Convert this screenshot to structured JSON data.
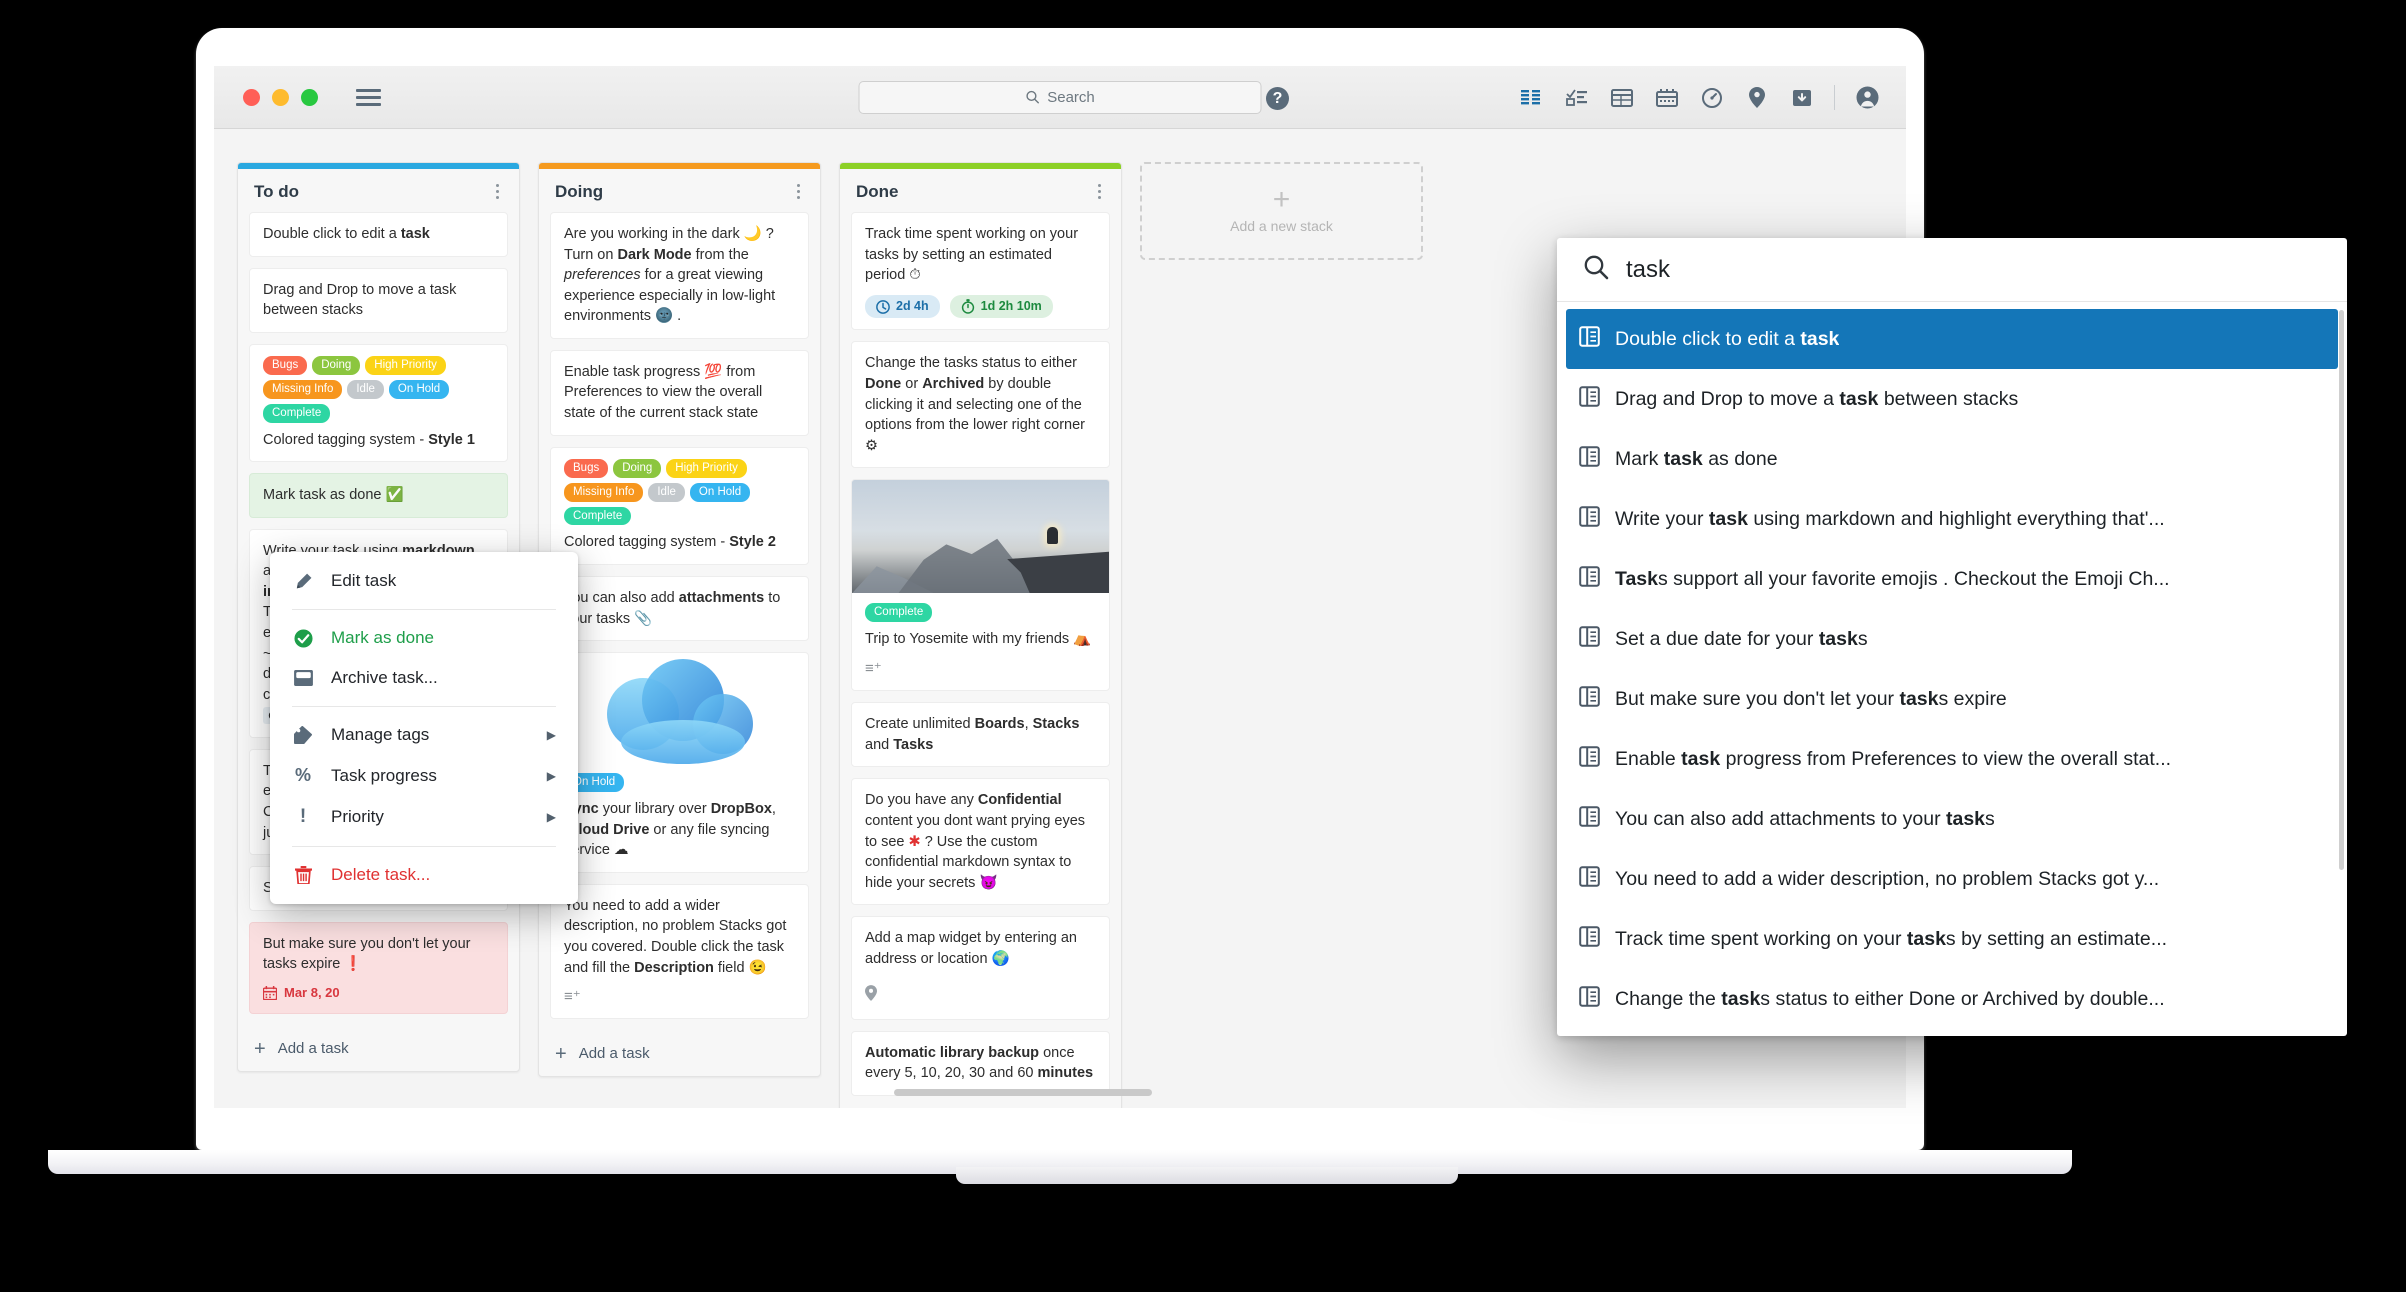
{
  "window": {
    "traffic_lights": [
      "close",
      "minimize",
      "maximize"
    ],
    "menu_icon": "hamburger-icon",
    "search_placeholder": "Search",
    "help_label": "?",
    "toolbar_icons": [
      "list-view-icon",
      "checklist-view-icon",
      "table-view-icon",
      "calendar-view-icon",
      "dashboard-icon",
      "map-pin-icon",
      "archive-icon",
      "separator",
      "account-avatar-icon"
    ]
  },
  "board": {
    "stacks": [
      {
        "title": "To do",
        "accent": "#29a8e0",
        "add_task_label": "Add a task",
        "cards": [
          {
            "id": "c1",
            "html": "Double click to edit a <b>task</b>"
          },
          {
            "id": "c2",
            "html": "Drag and Drop to move a task between stacks"
          },
          {
            "id": "c3",
            "tags": [
              "Bugs",
              "Doing",
              "High Priority",
              "Missing Info",
              "Idle",
              "On Hold",
              "Complete"
            ],
            "tag_style": 1,
            "html": "Colored tagging system - <b>Style 1</b>"
          },
          {
            "id": "c4",
            "state": "done",
            "html": "Mark task as done ✅"
          },
          {
            "id": "c5",
            "html": "Write your task using <b>markdown</b> and highlight everything that's <b>important</b> so you never <i>forget</i>. There also <u>underline</u> so you can emphasize the important things and ~~strike~~ everything that's already done. Almost forgot to mention, you can also enter links <span class='lnk'>Stacks</span> and <span class='codet'>code</span>"
          },
          {
            "id": "c6",
            "html": "Tasks support all your favorite emojis 😎 . Checkout the Emoji Cheatsheet in the Help menu or just paste one directly"
          },
          {
            "id": "c7",
            "html": "Set a due date for your tasks ⏰"
          },
          {
            "id": "c8",
            "state": "expired",
            "html": "But make sure you don't let your tasks expire ❗",
            "due_date": "Mar 8, 20"
          }
        ]
      },
      {
        "title": "Doing",
        "accent": "#f59a1e",
        "add_task_label": "Add a task",
        "cards": [
          {
            "id": "d1",
            "html": "Are you working in the dark 🌙 ? Turn on <b>Dark Mode</b> from the <i>preferences</i> for a great viewing experience especially in low-light environments 🌚 ."
          },
          {
            "id": "d2",
            "html": "Enable task progress 💯 from Preferences to view the overall state of the current stack state"
          },
          {
            "id": "d3",
            "tags": [
              "Bugs",
              "Doing",
              "High Priority",
              "Missing Info",
              "Idle",
              "On Hold",
              "Complete"
            ],
            "tag_style": 2,
            "html": "Colored tagging system - <b>Style 2</b>"
          },
          {
            "id": "d4",
            "html": "You can also add <b>attachments</b> to your tasks 📎"
          },
          {
            "id": "d5",
            "image": "icloud-cloud-image",
            "tags": [
              "On Hold"
            ],
            "html": "<b>Sync</b> your library over <b>DropBox</b>, <b>iCloud Drive</b> or any file syncing service ☁"
          },
          {
            "id": "d6",
            "has_description": true,
            "html": "You need to add a wider description, no problem Stacks got you covered. Double click the task and fill the <b>Description</b> field 😉"
          }
        ]
      },
      {
        "title": "Done",
        "accent": "#8cd026",
        "add_task_label": "",
        "cards": [
          {
            "id": "e1",
            "html": "Track time spent working on your tasks by setting an estimated period ⏱",
            "time_chips": [
              {
                "icon": "clock-icon",
                "label": "2d 4h",
                "style": "blue"
              },
              {
                "icon": "stopwatch-icon",
                "label": "1d 2h 10m",
                "style": "green"
              }
            ]
          },
          {
            "id": "e2",
            "html": "Change the tasks status to either <b>Done</b> or <b>Archived</b> by double clicking it and selecting one of the options from the lower right corner ⚙"
          },
          {
            "id": "e3",
            "image": "yosemite-photo",
            "tags": [
              "Complete"
            ],
            "has_description": true,
            "html": "Trip to Yosemite with my friends ⛺"
          },
          {
            "id": "e4",
            "html": "Create unlimited <b>Boards</b>, <b>Stacks</b> and <b>Tasks</b>"
          },
          {
            "id": "e5",
            "html": "Do you have any <b>Confidential</b> content you dont want prying eyes to see <span style='color:#e03131'>✱</span> ? Use the custom confidential markdown syntax to hide your secrets 😈"
          },
          {
            "id": "e6",
            "html": "Add a map widget by entering an address or location 🌍",
            "has_map_pin": true
          },
          {
            "id": "e7",
            "html": "<b>Automatic library backup</b> once every 5, 10, 20, 30 and 60 <b>minutes</b>"
          }
        ]
      }
    ],
    "new_stack": {
      "label": "Add a new stack",
      "icon": "plus-icon"
    }
  },
  "tag_colors": {
    "Bugs": "#fa6a4e",
    "Doing": "#8cc63f",
    "High Priority": "#fbd316",
    "Missing Info": "#f7961e",
    "Idle": "#c3c8cc",
    "On Hold": "#35b5f0",
    "Complete": "#2ed6a3"
  },
  "context_menu": {
    "items": [
      {
        "label": "Edit task",
        "icon": "pencil-icon",
        "style": "normal",
        "submenu": false
      },
      {
        "type": "separator"
      },
      {
        "label": "Mark as done",
        "icon": "check-circle-icon",
        "style": "green",
        "submenu": false
      },
      {
        "label": "Archive task...",
        "icon": "archive-box-icon",
        "style": "normal",
        "submenu": false
      },
      {
        "type": "separator"
      },
      {
        "label": "Manage tags",
        "icon": "tag-icon",
        "style": "normal",
        "submenu": true
      },
      {
        "label": "Task progress",
        "icon": "percent-icon",
        "style": "normal",
        "submenu": true
      },
      {
        "label": "Priority",
        "icon": "exclamation-icon",
        "style": "normal",
        "submenu": true
      },
      {
        "type": "separator"
      },
      {
        "label": "Delete task...",
        "icon": "trash-icon",
        "style": "red",
        "submenu": false
      }
    ]
  },
  "search_panel": {
    "query": "task",
    "search_icon": "search-icon",
    "selected_index": 0,
    "results": [
      {
        "html": "Double click to edit a <b>task</b>"
      },
      {
        "html": "Drag and Drop to move a <b>task</b> between stacks"
      },
      {
        "html": "Mark <b>task</b> as done"
      },
      {
        "html": "Write your <b>task</b> using markdown and highlight everything that'..."
      },
      {
        "html": "<b>Task</b>s support all your favorite emojis . Checkout the Emoji Ch..."
      },
      {
        "html": "Set a due date for your <b>task</b>s"
      },
      {
        "html": "But make sure you don't let your <b>task</b>s expire"
      },
      {
        "html": "Enable <b>task</b> progress from Preferences to view the overall stat..."
      },
      {
        "html": "You can also add attachments to your <b>task</b>s"
      },
      {
        "html": "You need to add a wider description, no problem Stacks got y..."
      },
      {
        "html": "Track time spent working on your <b>task</b>s by setting an estimate..."
      },
      {
        "html": "Change the <b>task</b>s status to either Done or Archived by double..."
      }
    ]
  }
}
